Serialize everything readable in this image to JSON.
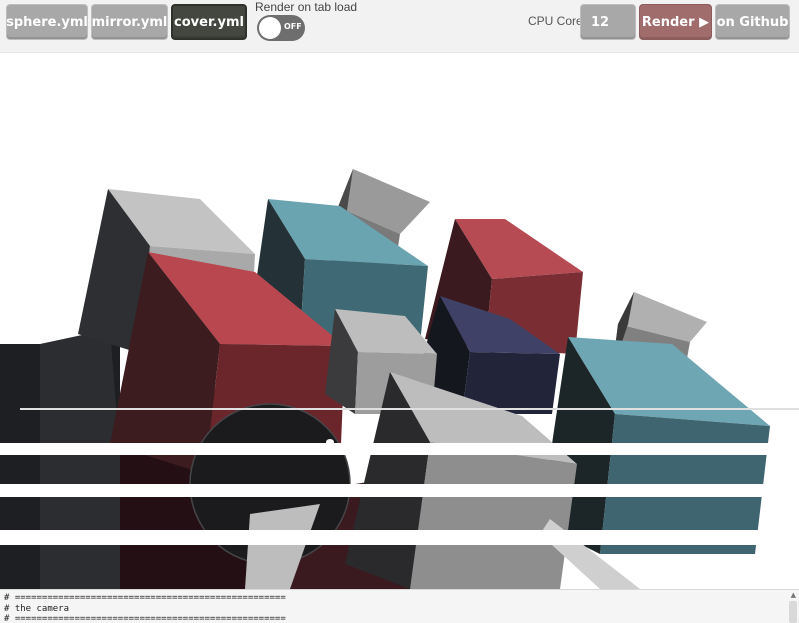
{
  "toolbar": {
    "presets": [
      {
        "label": "sphere.yml"
      },
      {
        "label": "mirror.yml"
      },
      {
        "label": "cover.yml"
      }
    ],
    "render_on_load": {
      "label": "Render on tab load",
      "state": "OFF"
    },
    "cores": {
      "label": "CPU Cores",
      "value": "12"
    },
    "render_button": "Render ▶",
    "github_button": "on Github"
  },
  "scene": {
    "description_icon": "rendered-cubes-scene",
    "colors": {
      "red": "#b44a50",
      "teal": "#5f9aa6",
      "white": "#c8c8c8",
      "dark": "#2a2b2e",
      "navy": "#3c3f5f"
    }
  },
  "editor": {
    "lines": [
      "# ==================================================",
      "# the camera",
      "# =================================================="
    ]
  }
}
